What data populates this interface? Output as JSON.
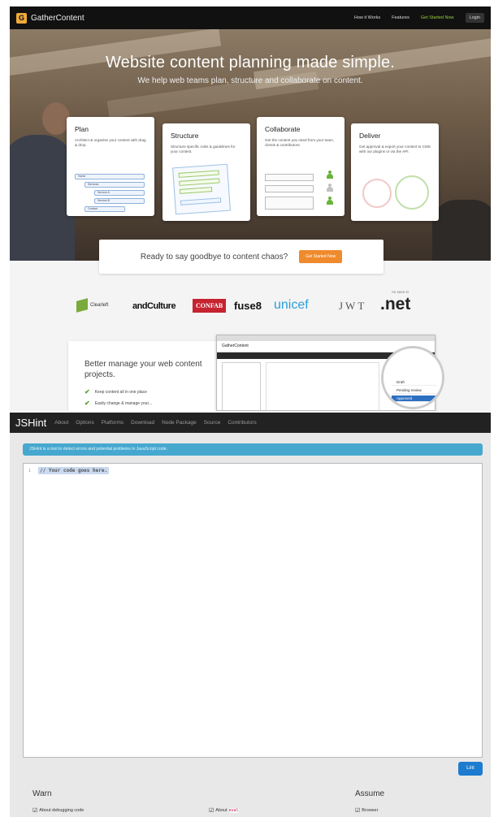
{
  "gathercontent": {
    "brand": {
      "mark": "G",
      "name": "GatherContent"
    },
    "nav": {
      "links": [
        "How it Works",
        "Features"
      ],
      "cta": "Get Started Now",
      "login": "Login"
    },
    "hero": {
      "title": "Website content planning made simple.",
      "subtitle": "We help web teams plan, structure and collaborate on content."
    },
    "cards": [
      {
        "title": "Plan",
        "text": "Architect & organise your content with drag & drop.",
        "tree": [
          "Home",
          "Services",
          "Service A",
          "Service B",
          "Contact"
        ]
      },
      {
        "title": "Structure",
        "text": "Structure specific rules & guidelines for your content."
      },
      {
        "title": "Collaborate",
        "text": "Get the content you need from your team, clients & contributors."
      },
      {
        "title": "Deliver",
        "text": "Get approval & export your content to CMS with our plugins or via the API."
      }
    ],
    "ready": {
      "text": "Ready to say goodbye to content chaos?",
      "button": "Get Started Now"
    },
    "logos": {
      "clearleft": "Clearleft",
      "andculture": "andCulture",
      "confab": "CONFAB",
      "fuse8": "fuse8",
      "unicef": "unicef",
      "jwt": "JWT",
      "net": ".net",
      "as_seen": "As seen in"
    },
    "better": {
      "title": "Better manage your web content projects.",
      "items": [
        "Keep content all in one place",
        "Easily change & manage your..."
      ]
    },
    "app": {
      "header": "GatherContent",
      "menu": [
        "Draft",
        "Pending review",
        "Approved"
      ]
    }
  },
  "jshint": {
    "brand": "JSHint",
    "nav": [
      "About",
      "Options",
      "Platforms",
      "Download",
      "Node Package",
      "Source",
      "Contributors"
    ],
    "banner": "JSHint is a tool to detect errors and potential problems in JavaScript code.",
    "editor": {
      "line_number": "1",
      "code": "// Your code goes here."
    },
    "lint_button": "Lint",
    "warn": {
      "title": "Warn",
      "options": [
        "About debugging code",
        "About"
      ],
      "eval_code": "eval"
    },
    "assume": {
      "title": "Assume",
      "options": [
        "Browser"
      ]
    },
    "colors": {
      "nav": "#222222",
      "banner": "#46a8cf",
      "lint": "#1e7ccf"
    }
  }
}
